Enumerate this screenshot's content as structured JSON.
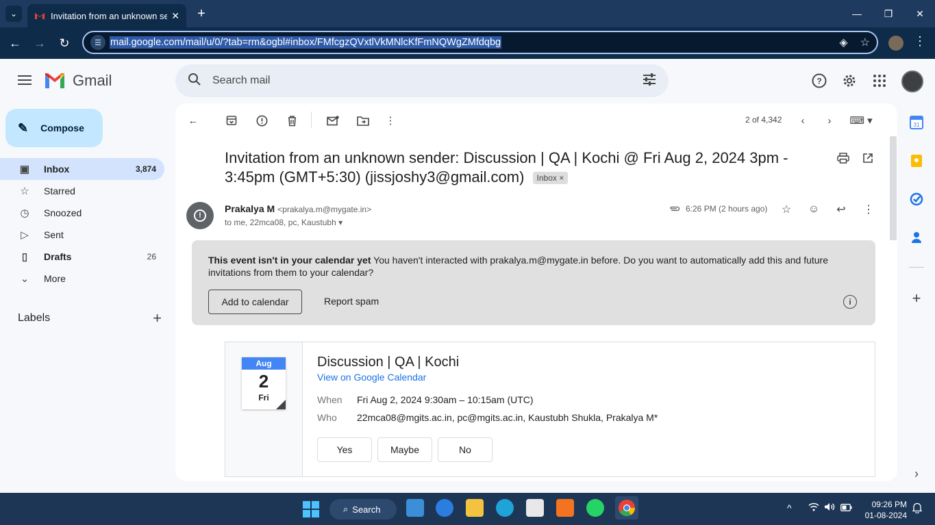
{
  "browser": {
    "tab_title": "Invitation from an unknown sender",
    "url": "mail.google.com/mail/u/0/?tab=rm&ogbl#inbox/FMfcgzQVxtlVkMNlcKfFmNQWgZMfdqbg"
  },
  "gmail": {
    "logo_text": "Gmail",
    "search_placeholder": "Search mail"
  },
  "sidebar": {
    "compose_label": "Compose",
    "items": [
      {
        "label": "Inbox",
        "count": "3,874",
        "icon": "inbox-icon"
      },
      {
        "label": "Starred",
        "count": "",
        "icon": "star-icon"
      },
      {
        "label": "Snoozed",
        "count": "",
        "icon": "clock-icon"
      },
      {
        "label": "Sent",
        "count": "",
        "icon": "send-icon"
      },
      {
        "label": "Drafts",
        "count": "26",
        "icon": "draft-icon"
      },
      {
        "label": "More",
        "count": "",
        "icon": "chevron-down-icon"
      }
    ],
    "labels_heading": "Labels"
  },
  "toolbar": {
    "pager": "2 of 4,342"
  },
  "message": {
    "subject": "Invitation from an unknown sender: Discussion | QA | Kochi @ Fri Aug 2, 2024 3pm - 3:45pm (GMT+5:30) (jissjoshy3@gmail.com)",
    "label_chip": "Inbox",
    "sender_name": "Prakalya M",
    "sender_email": "<prakalya.m@mygate.in>",
    "recipients": "to me, 22mca08, pc, Kaustubh",
    "time": "6:26 PM (2 hours ago)"
  },
  "banner": {
    "bold_text": "This event isn't in your calendar yet",
    "body_text": " You haven't interacted with prakalya.m@mygate.in before. Do you want to automatically add this and future invitations from them to your calendar?",
    "add_button": "Add to calendar",
    "spam_button": "Report spam"
  },
  "event": {
    "month": "Aug",
    "day": "2",
    "weekday": "Fri",
    "title": "Discussion | QA | Kochi",
    "link": "View on Google Calendar",
    "when_label": "When",
    "when_value": "Fri Aug 2, 2024 9:30am – 10:15am (UTC)",
    "who_label": "Who",
    "who_value": "22mca08@mgits.ac.in, pc@mgits.ac.in, Kaustubh Shukla, Prakalya M*",
    "rsvp": [
      "Yes",
      "Maybe",
      "No"
    ]
  },
  "taskbar": {
    "search_label": "Search",
    "time": "09:26 PM",
    "date": "01-08-2024"
  },
  "colors": {
    "accent": "#c2e7ff",
    "active_nav": "#d3e3fd",
    "calendar_blue": "#4285f4",
    "link": "#1a73e8"
  }
}
